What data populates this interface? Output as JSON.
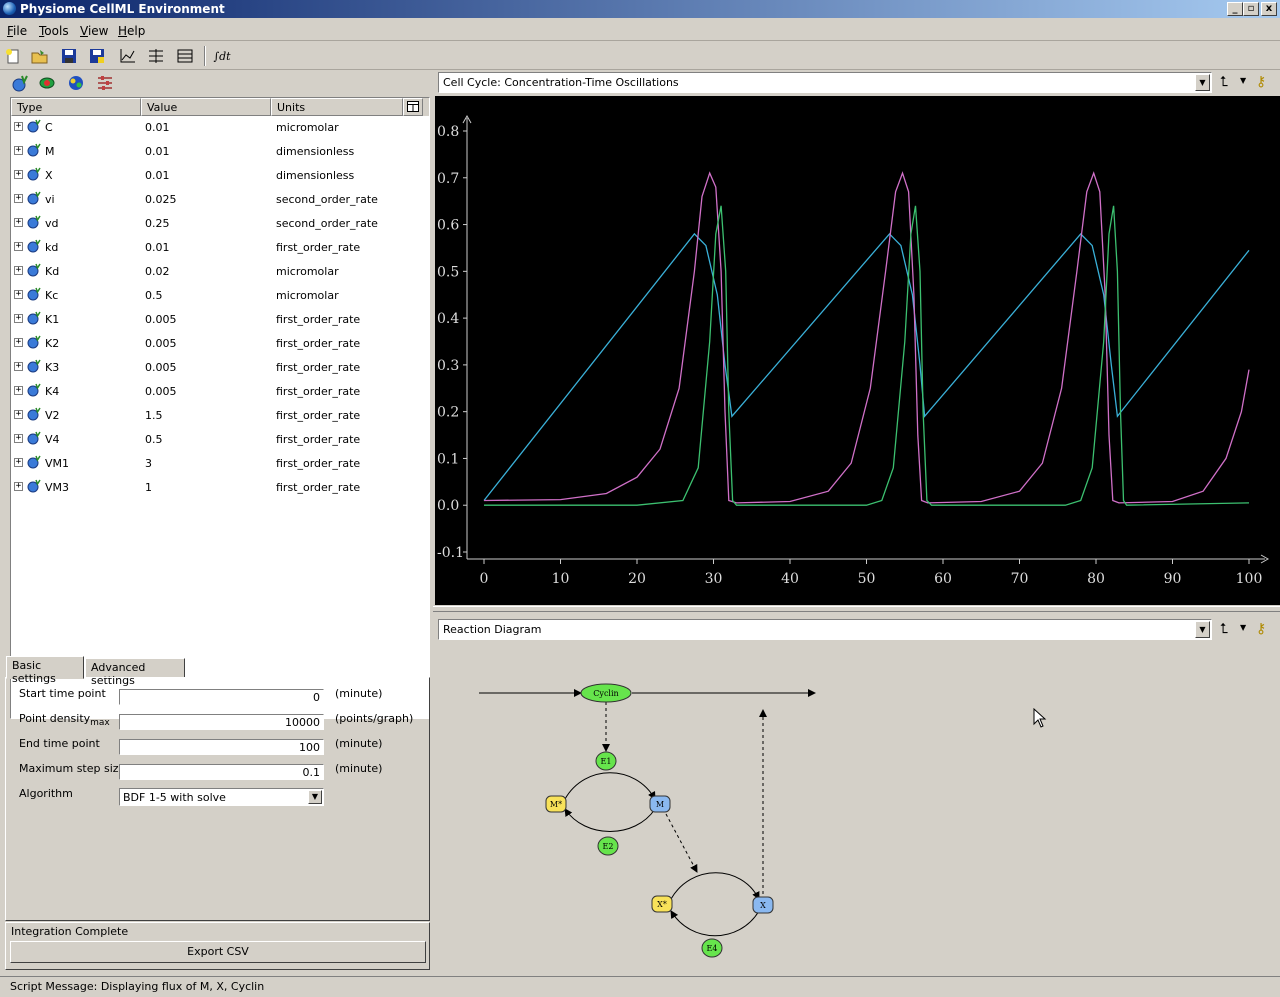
{
  "window": {
    "title": "Physiome CellML Environment",
    "buttons": [
      "_",
      "▫",
      "x"
    ]
  },
  "menu": [
    "File",
    "Tools",
    "View",
    "Help"
  ],
  "toolbar": {
    "integral_label": "∫dt"
  },
  "param_grid": {
    "columns": [
      "Type",
      "Value",
      "Units"
    ],
    "rows": [
      {
        "name": "C",
        "value": "0.01",
        "units": "micromolar"
      },
      {
        "name": "M",
        "value": "0.01",
        "units": "dimensionless"
      },
      {
        "name": "X",
        "value": "0.01",
        "units": "dimensionless"
      },
      {
        "name": "vi",
        "value": "0.025",
        "units": "second_order_rate"
      },
      {
        "name": "vd",
        "value": "0.25",
        "units": "second_order_rate"
      },
      {
        "name": "kd",
        "value": "0.01",
        "units": "first_order_rate"
      },
      {
        "name": "Kd",
        "value": "0.02",
        "units": "micromolar"
      },
      {
        "name": "Kc",
        "value": "0.5",
        "units": "micromolar"
      },
      {
        "name": "K1",
        "value": "0.005",
        "units": "first_order_rate"
      },
      {
        "name": "K2",
        "value": "0.005",
        "units": "first_order_rate"
      },
      {
        "name": "K3",
        "value": "0.005",
        "units": "first_order_rate"
      },
      {
        "name": "K4",
        "value": "0.005",
        "units": "first_order_rate"
      },
      {
        "name": "V2",
        "value": "1.5",
        "units": "first_order_rate"
      },
      {
        "name": "V4",
        "value": "0.5",
        "units": "first_order_rate"
      },
      {
        "name": "VM1",
        "value": "3",
        "units": "first_order_rate"
      },
      {
        "name": "VM3",
        "value": "1",
        "units": "first_order_rate"
      }
    ]
  },
  "settings": {
    "tabs": [
      "Basic settings",
      "Advanced settings"
    ],
    "start_label": "Start time point",
    "start_value": "0",
    "start_unit": "(minute)",
    "density_label": "Point density",
    "density_sub": "max",
    "density_value": "10000",
    "density_unit": "(points/graph)",
    "end_label": "End time point",
    "end_value": "100",
    "end_unit": "(minute)",
    "step_label": "Maximum step size",
    "step_value": "0.1",
    "step_unit": "(minute)",
    "algorithm_label": "Algorithm",
    "algorithm_value": "BDF 1-5 with solve"
  },
  "status": {
    "message": "Integration Complete",
    "export_label": "Export CSV"
  },
  "plot_view": {
    "title": "Cell Cycle: Concentration-Time Oscillations"
  },
  "diagram_view": {
    "title": "Reaction Diagram"
  },
  "script_message": "Script Message: Displaying flux of M, X, Cyclin",
  "colors": {
    "series_C": "#3ab0d8",
    "series_M": "#d070c8",
    "series_X": "#3cc070",
    "plot_bg": "#000000"
  },
  "chart_data": {
    "type": "line",
    "title": "",
    "xlabel": "",
    "ylabel": "",
    "xlim": [
      0,
      100
    ],
    "ylim": [
      -0.1,
      0.8
    ],
    "xticks": [
      0,
      10,
      20,
      30,
      40,
      50,
      60,
      70,
      80,
      90,
      100
    ],
    "yticks": [
      0.8,
      0.7,
      0.6,
      0.5,
      0.4,
      0.3,
      0.2,
      0.1,
      0.0,
      -0.1
    ],
    "ytick_labels": [
      "0.8",
      "0.7",
      "0.6",
      "0.5",
      "0.4",
      "0.3",
      "0.2",
      "0.1",
      "0.0",
      "-0.1"
    ],
    "series": [
      {
        "color": "#3ab0d8",
        "x": [
          0,
          27.5,
          29,
          30.5,
          31.5,
          32.4,
          57.6,
          55,
          56.5,
          58,
          82.8,
          80.5,
          81.5,
          83,
          100
        ],
        "points": [
          [
            0,
            0.01
          ],
          [
            27.5,
            0.58
          ],
          [
            29,
            0.555
          ],
          [
            30.5,
            0.45
          ],
          [
            31.5,
            0.3
          ],
          [
            32.4,
            0.19
          ],
          [
            53,
            0.58
          ],
          [
            54.5,
            0.555
          ],
          [
            56,
            0.45
          ],
          [
            57,
            0.3
          ],
          [
            57.6,
            0.19
          ],
          [
            78,
            0.58
          ],
          [
            79.5,
            0.555
          ],
          [
            81,
            0.45
          ],
          [
            82,
            0.3
          ],
          [
            82.8,
            0.19
          ],
          [
            100,
            0.545
          ]
        ]
      },
      {
        "color": "#d070c8",
        "points": [
          [
            0,
            0.01
          ],
          [
            10,
            0.012
          ],
          [
            16,
            0.025
          ],
          [
            20,
            0.06
          ],
          [
            23,
            0.12
          ],
          [
            25.5,
            0.25
          ],
          [
            27.5,
            0.5
          ],
          [
            28.5,
            0.66
          ],
          [
            29.5,
            0.71
          ],
          [
            30.3,
            0.68
          ],
          [
            31,
            0.5
          ],
          [
            31.5,
            0.2
          ],
          [
            32,
            0.01
          ],
          [
            33,
            0.005
          ],
          [
            40,
            0.008
          ],
          [
            45,
            0.03
          ],
          [
            48,
            0.09
          ],
          [
            50.5,
            0.25
          ],
          [
            52.5,
            0.5
          ],
          [
            53.8,
            0.67
          ],
          [
            54.7,
            0.71
          ],
          [
            55.5,
            0.67
          ],
          [
            56.2,
            0.45
          ],
          [
            56.7,
            0.15
          ],
          [
            57.2,
            0.01
          ],
          [
            58,
            0.005
          ],
          [
            65,
            0.008
          ],
          [
            70,
            0.03
          ],
          [
            73,
            0.09
          ],
          [
            75.5,
            0.25
          ],
          [
            77.5,
            0.5
          ],
          [
            78.8,
            0.67
          ],
          [
            79.7,
            0.71
          ],
          [
            80.5,
            0.67
          ],
          [
            81.2,
            0.45
          ],
          [
            81.7,
            0.15
          ],
          [
            82.2,
            0.01
          ],
          [
            83,
            0.005
          ],
          [
            90,
            0.008
          ],
          [
            94,
            0.03
          ],
          [
            97,
            0.1
          ],
          [
            99,
            0.2
          ],
          [
            100,
            0.29
          ]
        ]
      },
      {
        "color": "#3cc070",
        "points": [
          [
            0,
            0.0
          ],
          [
            20,
            0.0
          ],
          [
            26,
            0.01
          ],
          [
            28,
            0.08
          ],
          [
            29.5,
            0.35
          ],
          [
            30.3,
            0.58
          ],
          [
            31,
            0.64
          ],
          [
            31.6,
            0.5
          ],
          [
            32,
            0.2
          ],
          [
            32.5,
            0.01
          ],
          [
            33,
            0.0
          ],
          [
            50,
            0.0
          ],
          [
            52,
            0.01
          ],
          [
            53.5,
            0.08
          ],
          [
            55,
            0.35
          ],
          [
            55.8,
            0.58
          ],
          [
            56.4,
            0.64
          ],
          [
            57,
            0.5
          ],
          [
            57.4,
            0.2
          ],
          [
            57.9,
            0.01
          ],
          [
            58.5,
            0.0
          ],
          [
            76,
            0.0
          ],
          [
            78,
            0.01
          ],
          [
            79.5,
            0.08
          ],
          [
            81,
            0.35
          ],
          [
            81.7,
            0.58
          ],
          [
            82.3,
            0.64
          ],
          [
            82.8,
            0.5
          ],
          [
            83.2,
            0.2
          ],
          [
            83.6,
            0.01
          ],
          [
            84,
            0.0
          ],
          [
            100,
            0.005
          ]
        ]
      }
    ]
  },
  "diagram": {
    "nodes": [
      {
        "id": "Cyclin",
        "label": "Cyclin",
        "color": "#66e44c"
      },
      {
        "id": "E1",
        "label": "E1",
        "color": "#66e44c"
      },
      {
        "id": "Mstar",
        "label": "M*",
        "color": "#f8e25a"
      },
      {
        "id": "M",
        "label": "M",
        "color": "#8ab8f0"
      },
      {
        "id": "E2",
        "label": "E2",
        "color": "#66e44c"
      },
      {
        "id": "Xstar",
        "label": "X*",
        "color": "#f8e25a"
      },
      {
        "id": "X",
        "label": "X",
        "color": "#8ab8f0"
      },
      {
        "id": "E4",
        "label": "E4",
        "color": "#66e44c"
      }
    ]
  }
}
